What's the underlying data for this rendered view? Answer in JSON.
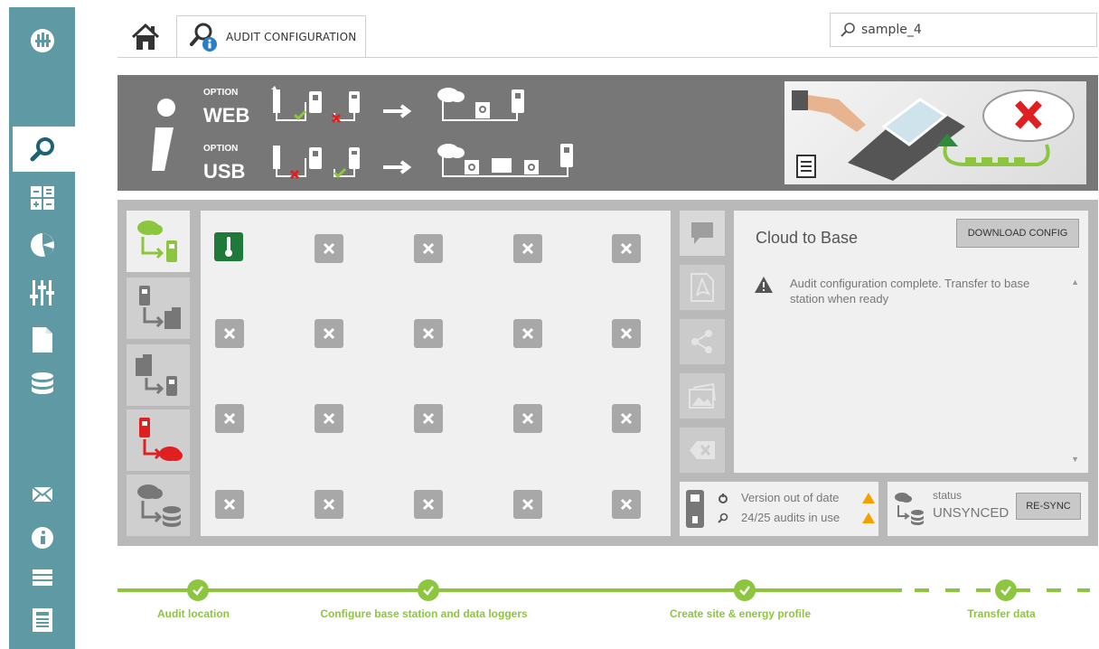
{
  "header": {
    "tab_label": "AUDIT CONFIGURATION",
    "search_value": "sample_4"
  },
  "banner": {
    "option_web_label": "OPTION",
    "option_web_value": "WEB",
    "option_usb_label": "OPTION",
    "option_usb_value": "USB"
  },
  "info_panel": {
    "title": "Cloud to Base",
    "download_button": "DOWNLOAD CONFIG",
    "message": "Audit configuration complete. Transfer to base station when ready"
  },
  "status_bar": {
    "version_text": "Version out of date",
    "audits_text": "24/25 audits in use",
    "status_label": "status",
    "status_value": "UNSYNCED",
    "resync_button": "RE-SYNC"
  },
  "progress": {
    "steps": [
      {
        "label": "Audit location"
      },
      {
        "label": "Configure base station and data loggers"
      },
      {
        "label": "Create site & energy profile"
      },
      {
        "label": "Transfer data"
      }
    ]
  },
  "colors": {
    "sidebar": "#5f9aa4",
    "accent_green": "#8cc63f",
    "warning": "#f4a100",
    "alert_red": "#e02020"
  }
}
